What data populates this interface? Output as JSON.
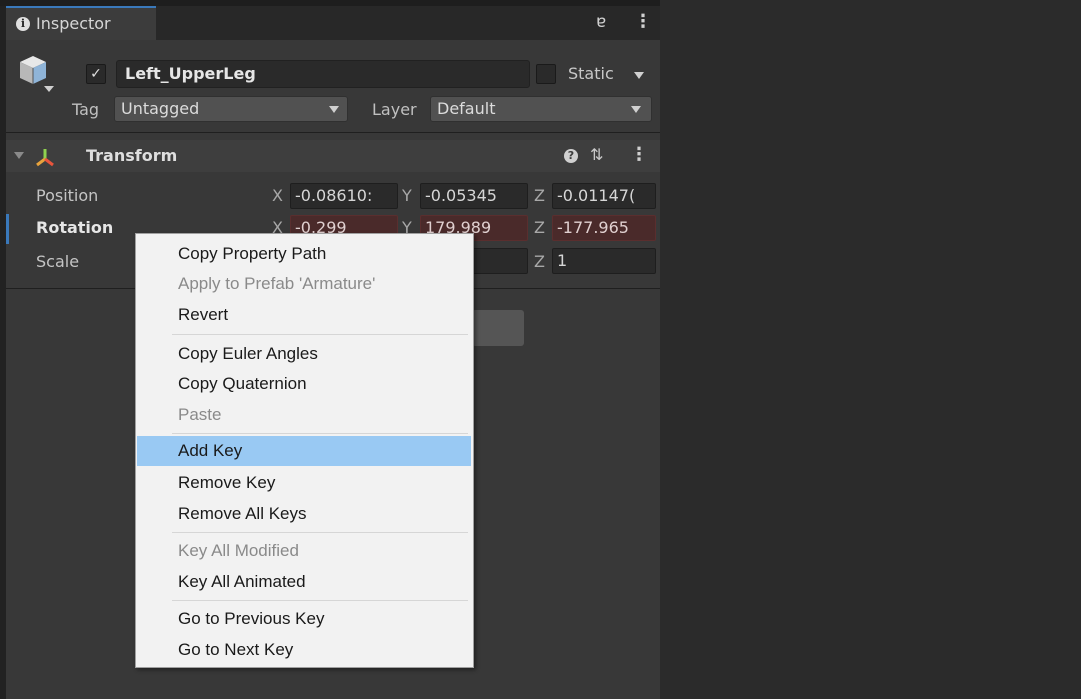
{
  "tab": {
    "label": "Inspector",
    "info_icon": "i"
  },
  "object": {
    "name": "Left_UpperLeg",
    "active_checked": true,
    "static_label": "Static",
    "static_checked": false,
    "tag_label": "Tag",
    "tag_value": "Untagged",
    "layer_label": "Layer",
    "layer_value": "Default"
  },
  "transform": {
    "title": "Transform",
    "position": {
      "label": "Position",
      "x": "-0.08610:",
      "y": "-0.05345",
      "z": "-0.01147("
    },
    "rotation": {
      "label": "Rotation",
      "x": "-0.299",
      "y": "179.989",
      "z": "-177.965"
    },
    "scale": {
      "label": "Scale",
      "z": "1"
    },
    "axis_x": "X",
    "axis_y": "Y",
    "axis_z": "Z"
  },
  "context_menu": {
    "items": [
      {
        "label": "Copy Property Path",
        "disabled": false
      },
      {
        "label": "Apply to Prefab 'Armature'",
        "disabled": true
      },
      {
        "label": "Revert",
        "disabled": false
      },
      {
        "label": "Copy Euler Angles",
        "disabled": false
      },
      {
        "label": "Copy Quaternion",
        "disabled": false
      },
      {
        "label": "Paste",
        "disabled": true
      },
      {
        "label": "Add Key",
        "disabled": false,
        "highlighted": true
      },
      {
        "label": "Remove Key",
        "disabled": false
      },
      {
        "label": "Remove All Keys",
        "disabled": false
      },
      {
        "label": "Key All Modified",
        "disabled": true
      },
      {
        "label": "Key All Animated",
        "disabled": false
      },
      {
        "label": "Go to Previous Key",
        "disabled": false
      },
      {
        "label": "Go to Next Key",
        "disabled": false
      }
    ]
  },
  "colors": {
    "panel": "#383838",
    "background": "#2b2b2b",
    "animated_field": "#4a2a2a",
    "menu_highlight": "#99c9f3",
    "tab_accent": "#3a79bb"
  },
  "icons": [
    "info-icon",
    "lock-icon",
    "more-vert-icon",
    "gameobject-cube-icon",
    "transform-axes-icon",
    "help-icon",
    "presets-icon",
    "dropdown-arrow-icon",
    "foldout-arrow-icon",
    "checkmark-icon"
  ]
}
